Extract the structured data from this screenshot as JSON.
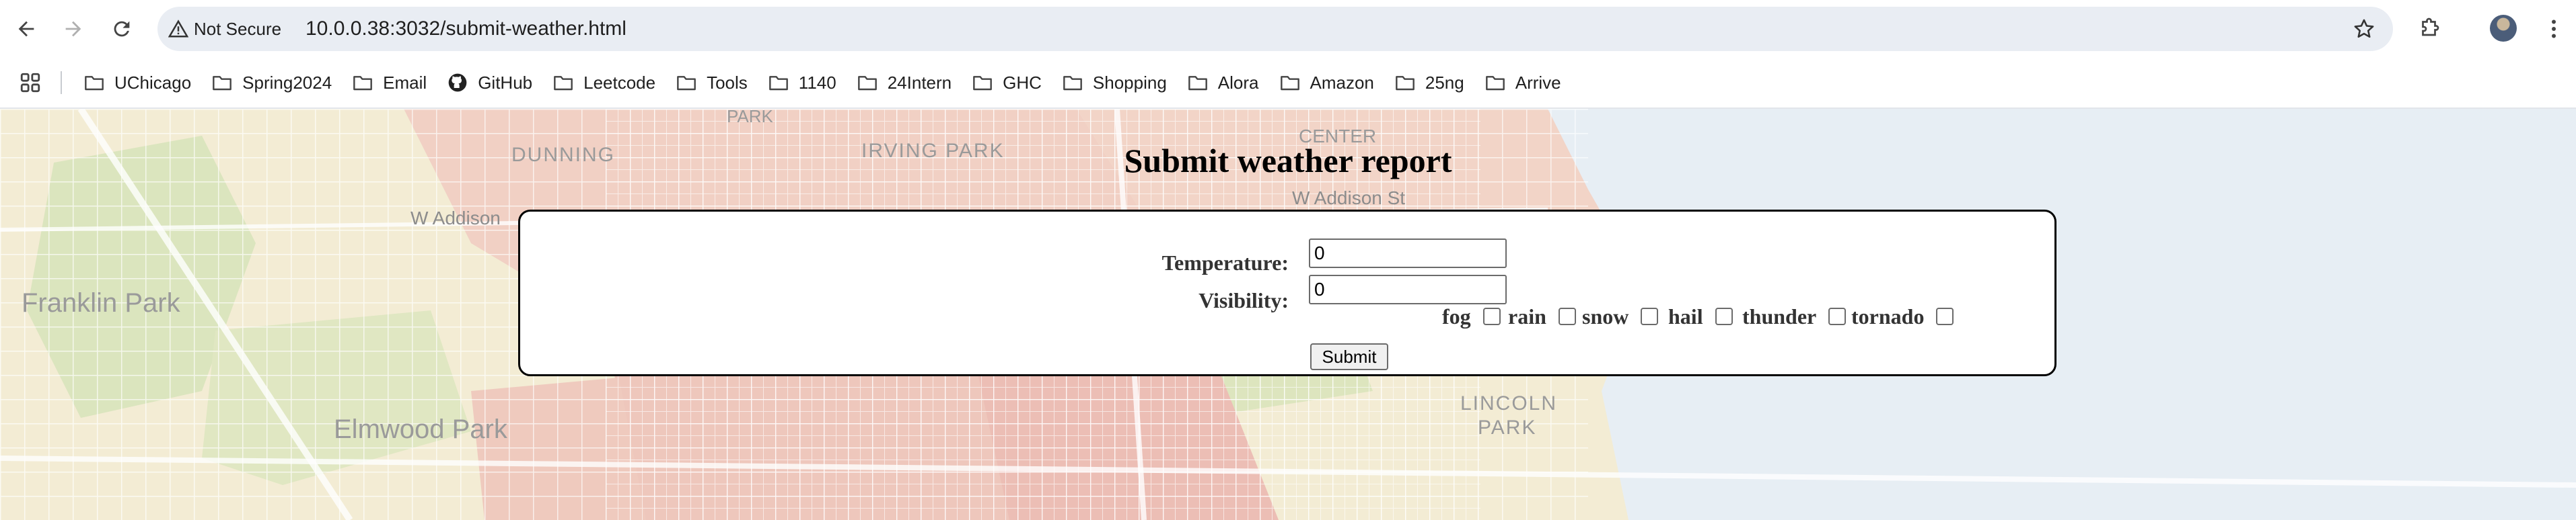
{
  "browser": {
    "security_label": "Not Secure",
    "url": "10.0.0.38:3032/submit-weather.html",
    "bookmarks": [
      "UChicago",
      "Spring2024",
      "Email",
      "GitHub",
      "Leetcode",
      "Tools",
      "1140",
      "24Intern",
      "GHC",
      "Shopping",
      "Alora",
      "Amazon",
      "25ng",
      "Arrive"
    ]
  },
  "page": {
    "title": "Submit weather report",
    "map_labels": {
      "dunning": "DUNNING",
      "irving_park": "IRVING PARK",
      "w_addison": "W Addison",
      "w_addison_st": "W Addison St",
      "franklin_park": "Franklin Park",
      "elmwood_park": "Elmwood Park",
      "lincoln_park_1": "LINCOLN",
      "lincoln_park_2": "PARK",
      "center": "CENTER",
      "park": "PARK"
    },
    "form": {
      "temperature_label": "Temperature:",
      "temperature_value": "0",
      "visibility_label": "Visibility:",
      "visibility_value": "0",
      "conditions": [
        {
          "label": "fog",
          "checked": false
        },
        {
          "label": "rain",
          "checked": false
        },
        {
          "label": "snow",
          "checked": false
        },
        {
          "label": "hail",
          "checked": false
        },
        {
          "label": "thunder",
          "checked": false
        },
        {
          "label": "tornado",
          "checked": false
        }
      ],
      "submit_label": "Submit"
    }
  },
  "colors": {
    "map_land": "#efe6c6",
    "map_water": "#dfe8f1",
    "map_urban_red": "#ecb3a8",
    "map_green": "#c9d9a4"
  }
}
